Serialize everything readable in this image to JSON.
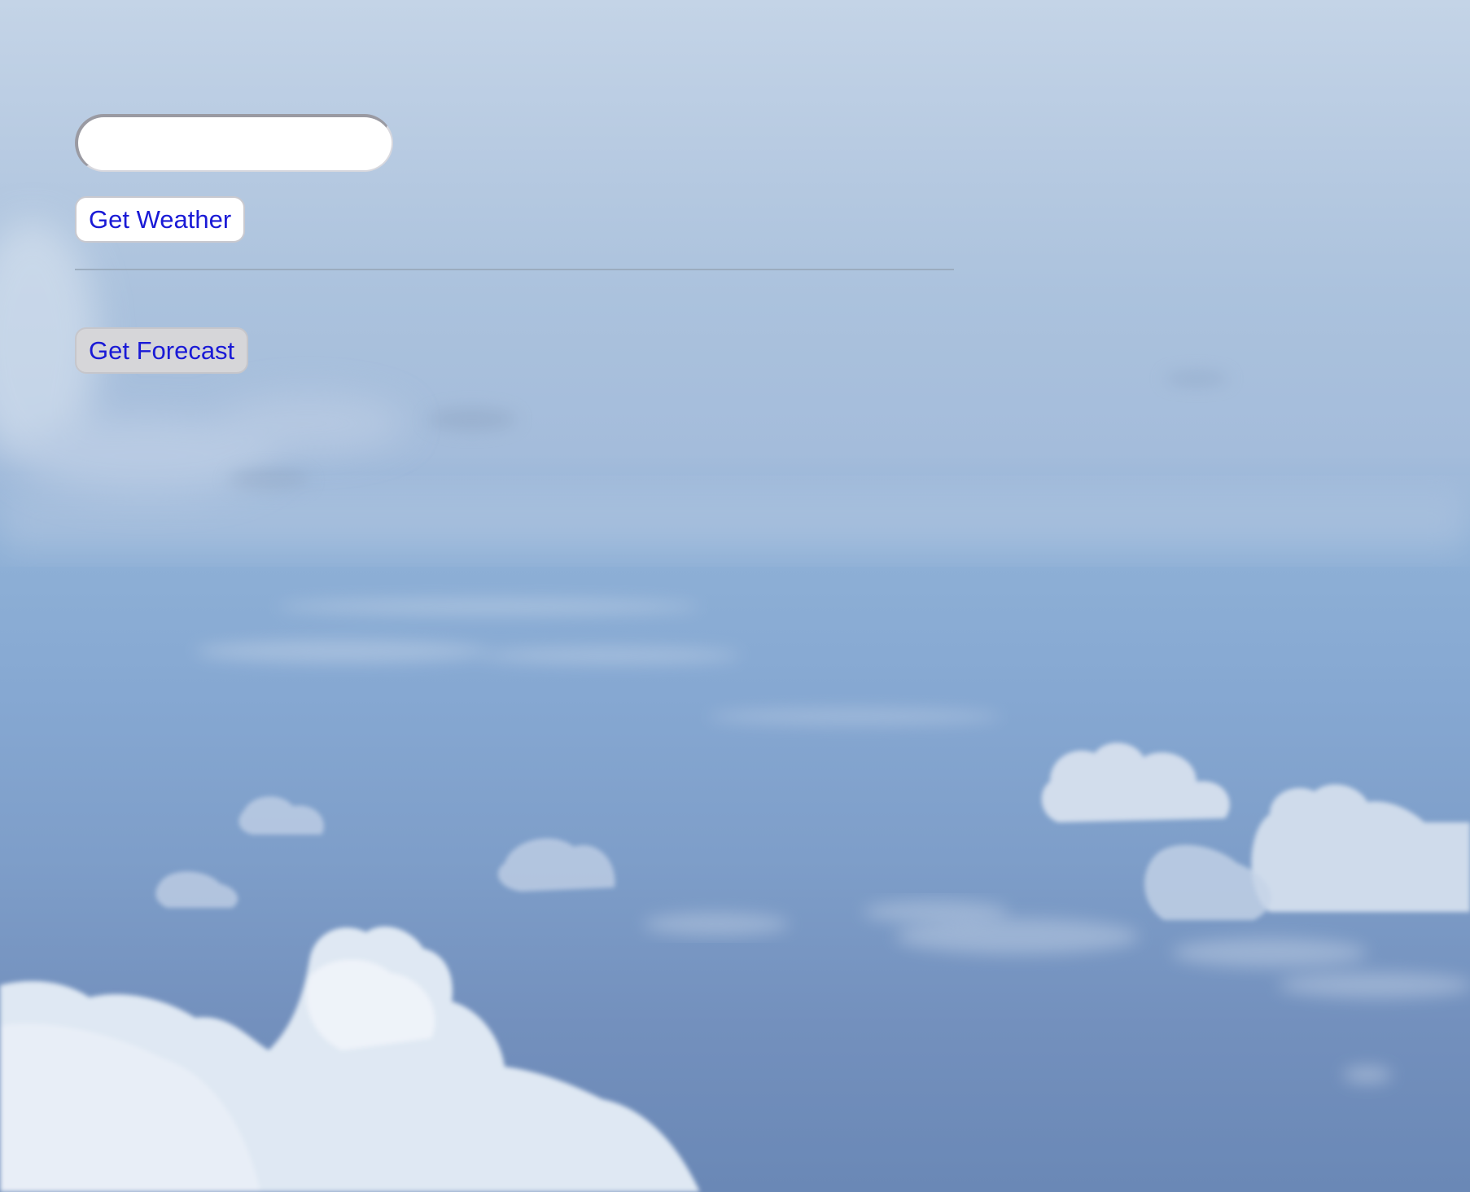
{
  "search": {
    "value": "",
    "placeholder": ""
  },
  "actions": {
    "weather_label": "Get Weather",
    "forecast_label": "Get Forecast"
  },
  "colors": {
    "button_text": "#1a1ad6",
    "weather_button_bg": "#ffffff",
    "forecast_button_bg": "#d6d6d9",
    "sky_top": "#c4d4e7",
    "sky_bottom": "#6a88b6"
  },
  "background": {
    "icon": "sky-clouds-photo"
  }
}
